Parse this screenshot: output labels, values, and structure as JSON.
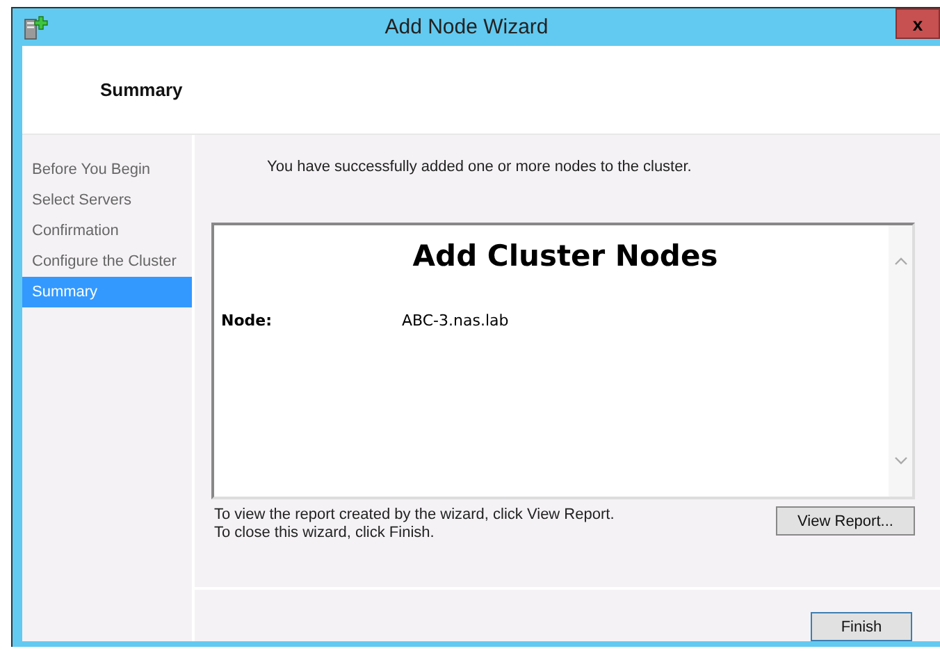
{
  "window": {
    "title": "Add Node Wizard",
    "close": "x"
  },
  "header": {
    "title": "Summary"
  },
  "steps": [
    {
      "label": "Before You Begin",
      "selected": false
    },
    {
      "label": "Select Servers",
      "selected": false
    },
    {
      "label": "Confirmation",
      "selected": false
    },
    {
      "label": "Configure the Cluster",
      "selected": false
    },
    {
      "label": "Summary",
      "selected": true
    }
  ],
  "message": "You have successfully added one or more nodes to the cluster.",
  "report": {
    "title": "Add Cluster Nodes",
    "rows": [
      {
        "label": "Node:",
        "value": "ABC-3.nas.lab"
      }
    ]
  },
  "hints": [
    "To view the report created by the wizard, click View Report.",
    "To close this wizard, click Finish."
  ],
  "view_report_button": "View Report...",
  "finish_button": "Finish"
}
